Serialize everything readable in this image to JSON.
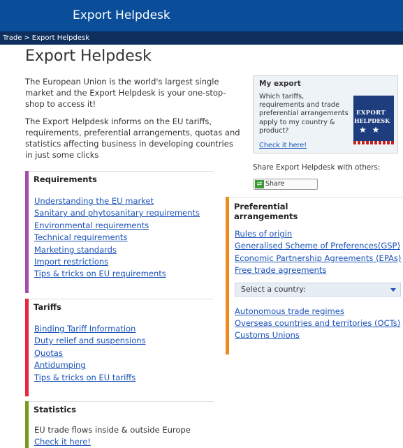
{
  "header": {
    "title": "Export Helpdesk"
  },
  "breadcrumb": {
    "items": [
      "Trade",
      "Export Helpdesk"
    ],
    "separator": ">"
  },
  "page_title": "Export Helpdesk",
  "intro": {
    "p1": "The European Union is the world's largest single market and the Export Helpdesk is your one-stop-shop to access it!",
    "p2": "The Export Helpdesk informs on the EU tariffs, requirements, preferential arrangements, quotas and statistics affecting business in developing countries in just some clicks"
  },
  "requirements": {
    "title": "Requirements",
    "links": [
      "Understanding the EU market",
      "Sanitary and phytosanitary requirements",
      "Environmental requirements",
      "Technical requirements",
      "Marketing standards",
      "Import restrictions",
      "Tips & tricks on EU requirements"
    ]
  },
  "tariffs": {
    "title": "Tariffs",
    "links": [
      "Binding Tariff Information",
      "Duty relief and suspensions",
      "Quotas",
      "Antidumping",
      "Tips & tricks on EU tariffs"
    ]
  },
  "statistics": {
    "title": "Statistics",
    "text": "EU trade flows inside & outside Europe",
    "link": "Check it here!"
  },
  "my_export": {
    "title": "My export",
    "text": "Which tariffs, requirements and trade preferential arrangements apply to my country & product?",
    "link": "Check it here!",
    "logo_line1": "EXPORT",
    "logo_line2": "HELPDESK"
  },
  "share": {
    "text": "Share Export Helpdesk with others:",
    "button": "Share"
  },
  "preferential": {
    "title_line1": "Preferential",
    "title_line2": "arrangements",
    "links": [
      "Rules of origin",
      "Generalised Scheme of Preferences(GSP)",
      "Economic Partnership Agreements (EPAs)",
      "Free trade agreements"
    ],
    "select_label": "Select a country:",
    "links2": [
      "Autonomous trade regimes",
      "Overseas countries and territories (OCTs)",
      "Customs Unions"
    ]
  },
  "colors": {
    "header_blue": "#0a4e9a",
    "breadcrumb_bar": "#0f2f5e",
    "requirements_accent": "#a64ca6",
    "tariffs_accent": "#e8283d",
    "statistics_accent": "#7a9a1e",
    "preferential_accent": "#f08a1c",
    "link": "#1a52b8"
  }
}
